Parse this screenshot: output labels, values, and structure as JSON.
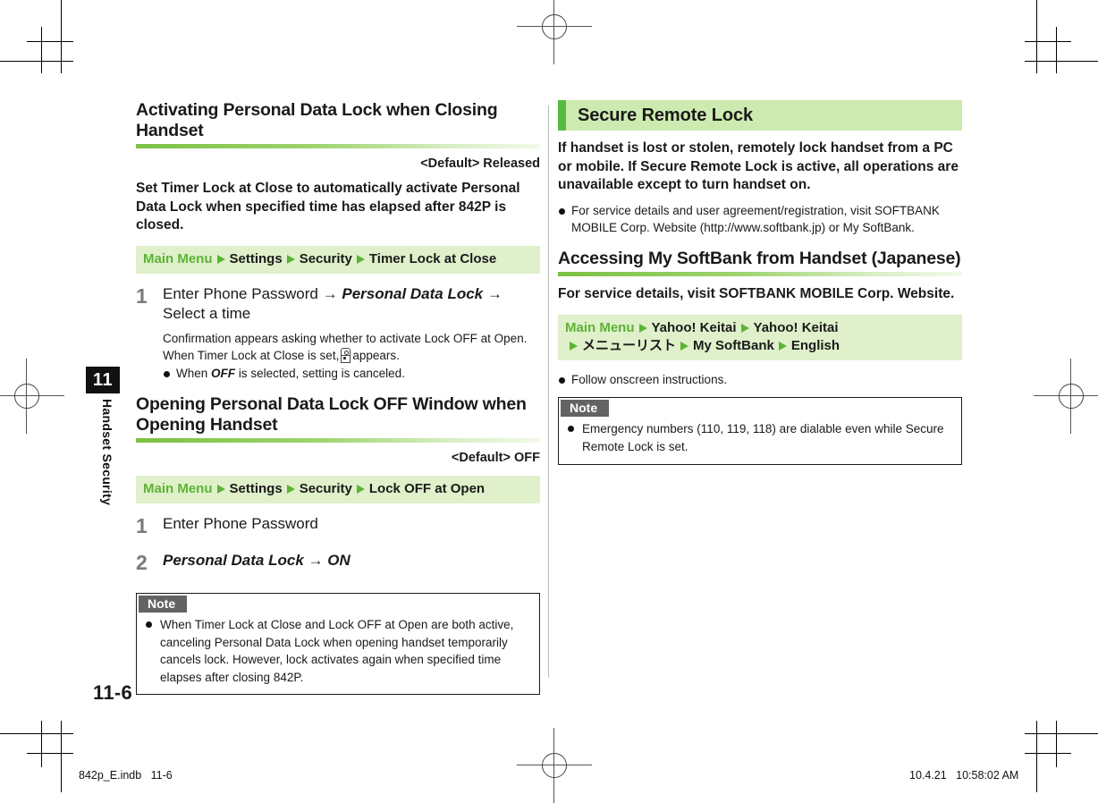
{
  "chapter": {
    "number": "11",
    "label": "Handset Security"
  },
  "page_number": "11-6",
  "footer": {
    "left": "842p_E.indb   11-6",
    "right": "10.4.21   10:58:02 AM"
  },
  "left_column": {
    "section1": {
      "heading": "Activating Personal Data Lock when Closing Handset",
      "default_label": "<Default> Released",
      "lead": "Set Timer Lock at Close to automatically activate Personal Data Lock when specified time has elapsed after 842P is closed.",
      "path": {
        "root": "Main Menu",
        "items": [
          "Settings",
          "Security",
          "Timer Lock at Close"
        ]
      },
      "step": {
        "number": "1",
        "text_before": "Enter Phone Password",
        "arrow1": "→",
        "italic1": "Personal Data Lock",
        "arrow2": "→",
        "text_after": "Select a time"
      },
      "sub_note_line1": "Confirmation appears asking whether to activate Lock OFF at Open.",
      "sub_note_line2_before": "When Timer Lock at Close is set,",
      "sub_note_icon": "timer-lock-icon",
      "sub_note_line2_after": "appears.",
      "sub_bullet_before": "When",
      "sub_bullet_italic": "OFF",
      "sub_bullet_after": "is selected, setting is canceled."
    },
    "section2": {
      "heading": "Opening Personal Data Lock OFF Window when Opening Handset",
      "default_label": "<Default> OFF",
      "path": {
        "root": "Main Menu",
        "items": [
          "Settings",
          "Security",
          "Lock OFF at Open"
        ]
      },
      "steps": [
        {
          "number": "1",
          "text": "Enter Phone Password",
          "italic": false
        },
        {
          "number": "2",
          "text": "Personal Data Lock → ON",
          "italic": true
        }
      ]
    },
    "note": {
      "title": "Note",
      "items": [
        "When Timer Lock at Close and Lock OFF at Open are both active, canceling Personal Data Lock when opening handset temporarily cancels lock. However, lock activates again when specified time elapses after closing 842P."
      ]
    }
  },
  "right_column": {
    "section_title": "Secure Remote Lock",
    "lead": "If handset is lost or stolen, remotely lock handset from a PC or mobile. If Secure Remote Lock is active, all operations are unavailable except to turn handset on.",
    "bullets": [
      "For service details and user agreement/registration, visit SOFTBANK MOBILE Corp. Website (http://www.softbank.jp) or My SoftBank."
    ],
    "sub_heading": "Accessing My SoftBank from Handset (Japanese)",
    "sub_lead": "For service details, visit SOFTBANK MOBILE Corp. Website.",
    "path": {
      "root": "Main Menu",
      "line1_items": [
        "Yahoo! Keitai",
        "Yahoo! Keitai"
      ],
      "line2_items": [
        "メニューリスト",
        "My SoftBank",
        "English"
      ]
    },
    "follow_bullet": "Follow onscreen instructions.",
    "note": {
      "title": "Note",
      "items": [
        "Emergency numbers (110, 119, 118) are dialable even while Secure Remote Lock is set."
      ]
    }
  },
  "colors": {
    "accent_green": "#57bb43",
    "banner_green": "#cdeab0",
    "path_green": "#dff0ca",
    "note_gray": "#636363"
  }
}
